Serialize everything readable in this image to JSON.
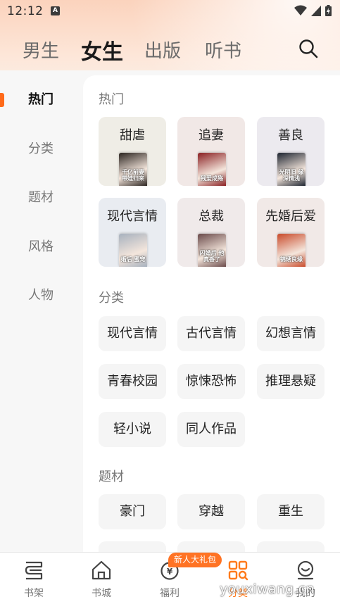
{
  "status_bar": {
    "time": "12:12",
    "app_badge": "A"
  },
  "top_tabs": [
    {
      "label": "男生"
    },
    {
      "label": "女生",
      "active": true
    },
    {
      "label": "出版"
    },
    {
      "label": "听书"
    }
  ],
  "search": {
    "icon": "search-icon"
  },
  "left_nav": [
    {
      "label": "热门",
      "active": true
    },
    {
      "label": "分类"
    },
    {
      "label": "题材"
    },
    {
      "label": "风格"
    },
    {
      "label": "人物"
    }
  ],
  "sections": {
    "hot": {
      "title": "热门",
      "cards": [
        {
          "label": "甜虐",
          "bg": "#efede6",
          "cover_text": "千亿前妻 带娃归来",
          "cover_color": "#2b2420"
        },
        {
          "label": "追妻",
          "bg": "#f1e8e6",
          "cover_text": "残爱成殇",
          "cover_color": "#8a1f22"
        },
        {
          "label": "善良",
          "bg": "#eceaef",
          "cover_text": "光阴旧 缘深情浅",
          "cover_color": "#1d2430"
        },
        {
          "label": "现代言情",
          "bg": "#e9ecf1",
          "cover_text": "婚后 蜜宠",
          "cover_color": "#a7b1be"
        },
        {
          "label": "总裁",
          "bg": "#f0eaea",
          "cover_text": "闪婚后 他真香了",
          "cover_color": "#6a4a4a"
        },
        {
          "label": "先婚后爱",
          "bg": "#f1e9e7",
          "cover_text": "锦绣良缘",
          "cover_color": "#c94a2a"
        }
      ]
    },
    "category": {
      "title": "分类",
      "chips": [
        "现代言情",
        "古代言情",
        "幻想言情",
        "青春校园",
        "惊悚恐怖",
        "推理悬疑",
        "轻小说",
        "同人作品"
      ]
    },
    "theme": {
      "title": "题材",
      "chips": [
        "豪门",
        "穿越",
        "重生"
      ]
    }
  },
  "bottom_nav": [
    {
      "label": "书架",
      "icon": "bookshelf-icon"
    },
    {
      "label": "书城",
      "icon": "bookstore-home-icon"
    },
    {
      "label": "福利",
      "icon": "welfare-coin-icon"
    },
    {
      "label": "分类",
      "icon": "category-grid-icon",
      "active": true
    },
    {
      "label": "我的",
      "icon": "profile-smile-icon"
    }
  ],
  "promo_badge": "新人大礼包",
  "watermark": "youxiwang.cn",
  "colors": {
    "accent": "#ff7324",
    "active_indicator": "#ff6a1a"
  }
}
